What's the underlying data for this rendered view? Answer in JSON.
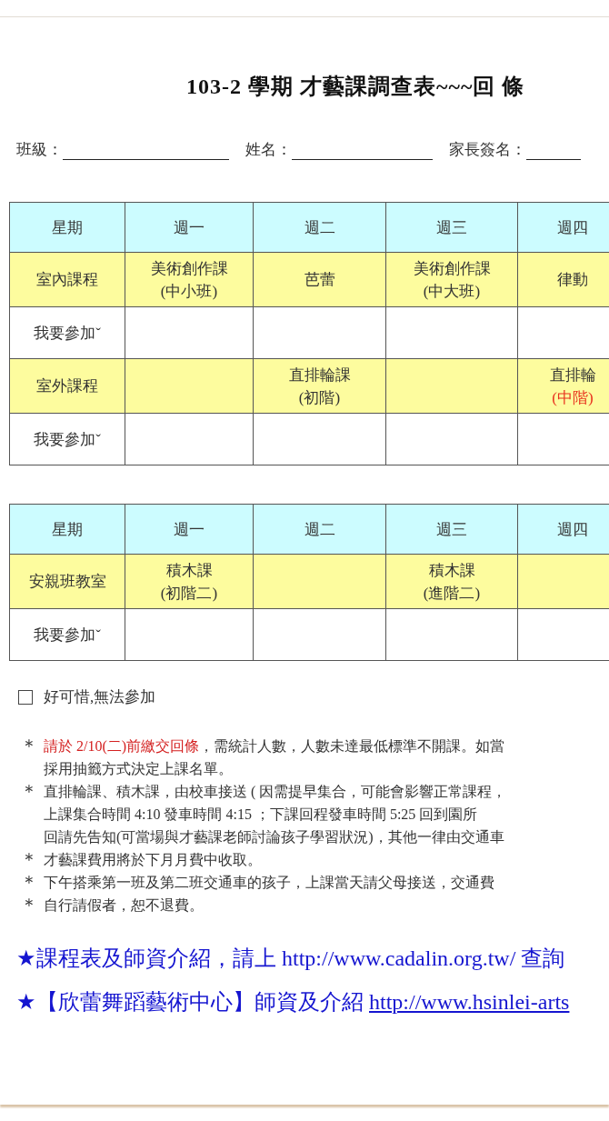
{
  "title": "103-2 學期 才藝課調查表~~~回 條",
  "form_fields": [
    {
      "label": "班級："
    },
    {
      "label": "姓名："
    },
    {
      "label": "家長簽名："
    }
  ],
  "tables": [
    {
      "columns": [
        "星期",
        "週一",
        "週二",
        "週三",
        "週四"
      ],
      "rows": [
        {
          "kind": "course",
          "cells": [
            [
              {
                "text": "室內課程"
              }
            ],
            [
              {
                "text": "美術創作課"
              },
              {
                "text": "(中小班)"
              }
            ],
            [
              {
                "text": "芭蕾"
              }
            ],
            [
              {
                "text": "美術創作課"
              },
              {
                "text": "(中大班)"
              }
            ],
            [
              {
                "text": "律動"
              }
            ]
          ]
        },
        {
          "kind": "signup",
          "cells": [
            [
              {
                "text": "我要參加ˇ"
              }
            ],
            [],
            [],
            [],
            []
          ]
        },
        {
          "kind": "course",
          "cells": [
            [
              {
                "text": "室外課程"
              }
            ],
            [],
            [
              {
                "text": "直排輪課"
              },
              {
                "text": "(初階)"
              }
            ],
            [],
            [
              {
                "text": "直排輪"
              },
              {
                "text": "(中階)",
                "color": "#e8321e"
              }
            ]
          ]
        },
        {
          "kind": "signup",
          "cells": [
            [
              {
                "text": "我要參加ˇ"
              }
            ],
            [],
            [],
            [],
            []
          ]
        }
      ]
    },
    {
      "columns": [
        "星期",
        "週一",
        "週二",
        "週三",
        "週四"
      ],
      "rows": [
        {
          "kind": "course",
          "cells": [
            [
              {
                "text": "安親班教室"
              }
            ],
            [
              {
                "text": "積木課"
              },
              {
                "text": "(初階二)"
              }
            ],
            [],
            [
              {
                "text": "積木課"
              },
              {
                "text": "(進階二)"
              }
            ],
            []
          ]
        },
        {
          "kind": "signup",
          "cells": [
            [
              {
                "text": "我要參加ˇ"
              }
            ],
            [],
            [],
            [],
            []
          ]
        }
      ]
    }
  ],
  "decline": {
    "label": "好可惜,無法參加",
    "checked": false
  },
  "notes": [
    {
      "bullet": "＊",
      "lead": "請於 2/10(二)前繳交回條",
      "lines": [
        "，需統計人數，人數未達最低標準不開課。如當",
        "採用抽籤方式決定上課名單。"
      ]
    },
    {
      "bullet": "＊",
      "lines": [
        "直排輪課、積木課，由校車接送 ( 因需提早集合，可能會影響正常課程，",
        "上課集合時間 4:10  發車時間  4:15  ；下課回程發車時間  5:25  回到園所",
        "回請先告知(可當場與才藝課老師討論孩子學習狀況)，其他一律由交通車"
      ]
    },
    {
      "bullet": "＊",
      "lines": [
        "才藝課費用將於下月月費中收取。"
      ]
    },
    {
      "bullet": "＊",
      "lines": [
        "下午搭乘第一班及第二班交通車的孩子，上課當天請父母接送，交通費"
      ]
    },
    {
      "bullet": "＊",
      "lines": [
        "自行請假者，恕不退費。"
      ]
    }
  ],
  "links": [
    {
      "star": "★",
      "text": "課程表及師資介紹，請上 http://www.cadalin.org.tw/  查詢"
    },
    {
      "star": "★",
      "text": "【欣蕾舞蹈藝術中心】師資及介紹",
      "url": "http://www.hsinlei-arts"
    }
  ]
}
